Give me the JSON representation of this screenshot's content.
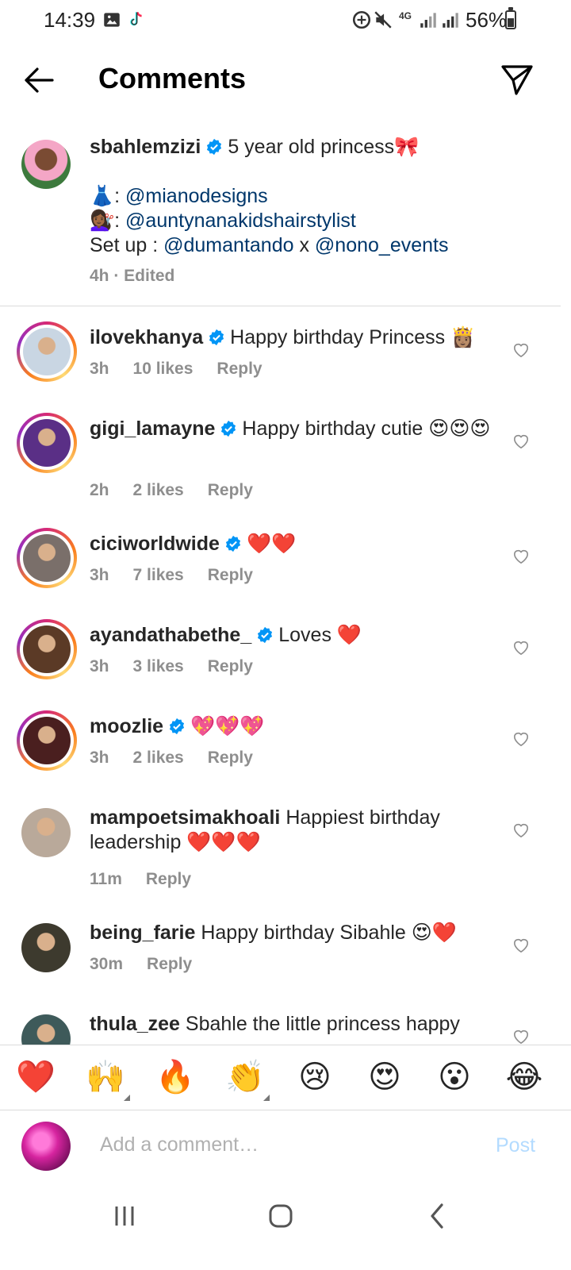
{
  "status_bar": {
    "time": "14:39",
    "network": "4G",
    "battery": "56%"
  },
  "header": {
    "title": "Comments"
  },
  "caption": {
    "username": "sbahlemzizi",
    "line1": "5 year old princess🎀",
    "dress_emoji": "👗",
    "mention1": "@mianodesigns",
    "hair_emoji": "💇🏾‍♀️",
    "mention2": "@auntynanakidshairstylist",
    "setup_label": "Set up : ",
    "mention3": "@dumantando",
    "setup_x": " x ",
    "mention4": "@nono_events",
    "meta": "4h · Edited"
  },
  "comments": [
    {
      "username": "ilovekhanya",
      "verified": true,
      "text": "Happy birthday Princess 👸🏽",
      "time": "3h",
      "likes": "10 likes",
      "reply": "Reply",
      "avatar_color": "#c9d6e3"
    },
    {
      "username": "gigi_lamayne",
      "verified": true,
      "text": "Happy birthday cutie 😍😍😍",
      "time": "2h",
      "likes": "2 likes",
      "reply": "Reply",
      "avatar_color": "#5a2f86"
    },
    {
      "username": "ciciworldwide",
      "verified": true,
      "text": "❤️❤️",
      "time": "3h",
      "likes": "7 likes",
      "reply": "Reply",
      "avatar_color": "#7a6f6a"
    },
    {
      "username": "ayandathabethe_",
      "verified": true,
      "text": "Loves ❤️",
      "time": "3h",
      "likes": "3 likes",
      "reply": "Reply",
      "avatar_color": "#5b3a26"
    },
    {
      "username": "moozlie",
      "verified": true,
      "text": "💖💖💖",
      "time": "3h",
      "likes": "2 likes",
      "reply": "Reply",
      "avatar_color": "#4a1f1f"
    },
    {
      "username": "mampoetsimakhoali",
      "verified": false,
      "text": "Happiest birthday leadership ❤️❤️❤️",
      "time": "11m",
      "likes": "",
      "reply": "Reply",
      "avatar_color": "#b9a99a"
    },
    {
      "username": "being_farie",
      "verified": false,
      "text": "Happy birthday Sibahle 😍❤️",
      "time": "30m",
      "likes": "",
      "reply": "Reply",
      "avatar_color": "#3d3a2e"
    },
    {
      "username": "thula_zee",
      "verified": false,
      "text": "Sbahle the little princess happy",
      "time": "",
      "likes": "",
      "reply": "",
      "avatar_color": "#3e5a5a"
    }
  ],
  "reactions": [
    "❤️",
    "🙌",
    "🔥",
    "👏",
    "😢",
    "😍",
    "😮",
    "😂"
  ],
  "input": {
    "placeholder": "Add a comment…",
    "post_label": "Post"
  },
  "colors": {
    "mention": "#00376b",
    "verified": "#0095f6",
    "post_disabled": "#b3dbff",
    "meta": "#8e8e8e"
  }
}
